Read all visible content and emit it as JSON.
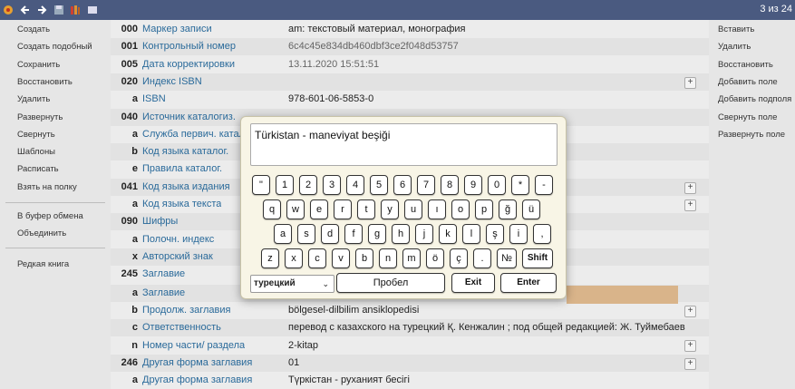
{
  "topbar": {
    "counter": "3 из 24",
    "icons": [
      "app-logo-icon",
      "back-arrow-icon",
      "forward-arrow-icon",
      "save-icon",
      "books-icon",
      "menu-icon"
    ]
  },
  "left_menu": {
    "items": [
      "Создать",
      "Создать подобный",
      "Сохранить",
      "Восстановить",
      "Удалить",
      "Развернуть",
      "Свернуть",
      "Шаблоны",
      "Расписать",
      "Взять на полку"
    ],
    "items2": [
      "В буфер обмена",
      "Объединить"
    ],
    "items3": [
      "Редкая книга"
    ]
  },
  "right_menu": {
    "items": [
      "Вставить",
      "Удалить",
      "Восстановить",
      "Добавить поле",
      "Добавить подполя",
      "Свернуть поле",
      "Развернуть поле"
    ]
  },
  "record": {
    "rows": [
      {
        "code": "000",
        "label": "Маркер записи",
        "value": "am: текстовый материал, монография",
        "gray": false
      },
      {
        "code": "001",
        "label": "Контрольный номер",
        "value": "6c4c45e834db460dbf3ce2f048d53757",
        "gray": true
      },
      {
        "code": "005",
        "label": "Дата корректировки",
        "value": "13.11.2020 15:51:51",
        "gray": true
      },
      {
        "code": "020",
        "label": "Индекс ISBN",
        "value": "",
        "gray": false
      },
      {
        "code": "a",
        "label": "ISBN",
        "value": "978-601-06-5853-0",
        "gray": false
      },
      {
        "code": "040",
        "label": "Источник каталогиз.",
        "value": "",
        "gray": false
      },
      {
        "code": "a",
        "label": "Служба первич. каталог",
        "value": "",
        "gray": false
      },
      {
        "code": "b",
        "label": "Код языка каталог.",
        "value": "",
        "gray": false
      },
      {
        "code": "e",
        "label": "Правила каталог.",
        "value": "",
        "gray": false
      },
      {
        "code": "041",
        "label": "Код языка издания",
        "value": "",
        "gray": false
      },
      {
        "code": "a",
        "label": "Код языка текста",
        "value": "",
        "gray": false
      },
      {
        "code": "090",
        "label": "Шифры",
        "value": "",
        "gray": false
      },
      {
        "code": "a",
        "label": "Полочн. индекс",
        "value": "",
        "gray": false
      },
      {
        "code": "x",
        "label": "Авторский знак",
        "value": "",
        "gray": false
      },
      {
        "code": "245",
        "label": "Заглавие",
        "value": "",
        "gray": false
      },
      {
        "code": "a",
        "label": "Заглавие",
        "value": "",
        "gray": false
      },
      {
        "code": "b",
        "label": "Продолж. заглавия",
        "value": "bölgesel-dilbilim ansiklopedisi",
        "gray": false
      },
      {
        "code": "c",
        "label": "Ответственность",
        "value": "перевод с казахского на турецкий Қ. Кенжалин ; под общей редакцией: Ж. Туймебаев",
        "gray": false
      },
      {
        "code": "n",
        "label": "Номер части/ раздела",
        "value": "2-kitap",
        "gray": false
      },
      {
        "code": "246",
        "label": "Другая форма заглавия",
        "value": "01",
        "gray": false
      },
      {
        "code": "a",
        "label": "Другая форма заглавия",
        "value": "Түркістан - руханият бесігі",
        "gray": false
      }
    ]
  },
  "keyboard": {
    "text": "Türkistan - maneviyat beşiği",
    "row1": [
      "\"",
      "1",
      "2",
      "3",
      "4",
      "5",
      "6",
      "7",
      "8",
      "9",
      "0",
      "*",
      "-"
    ],
    "row2": [
      "q",
      "w",
      "e",
      "r",
      "t",
      "y",
      "u",
      "ı",
      "o",
      "p",
      "ğ",
      "ü"
    ],
    "row3": [
      "a",
      "s",
      "d",
      "f",
      "g",
      "h",
      "j",
      "k",
      "l",
      "ş",
      "i",
      ","
    ],
    "row4": [
      "z",
      "x",
      "c",
      "v",
      "b",
      "n",
      "m",
      "ö",
      "ç",
      ".",
      "№"
    ],
    "shift": "Shift",
    "language": "турецкий",
    "space": "Пробел",
    "exit": "Exit",
    "enter": "Enter"
  }
}
